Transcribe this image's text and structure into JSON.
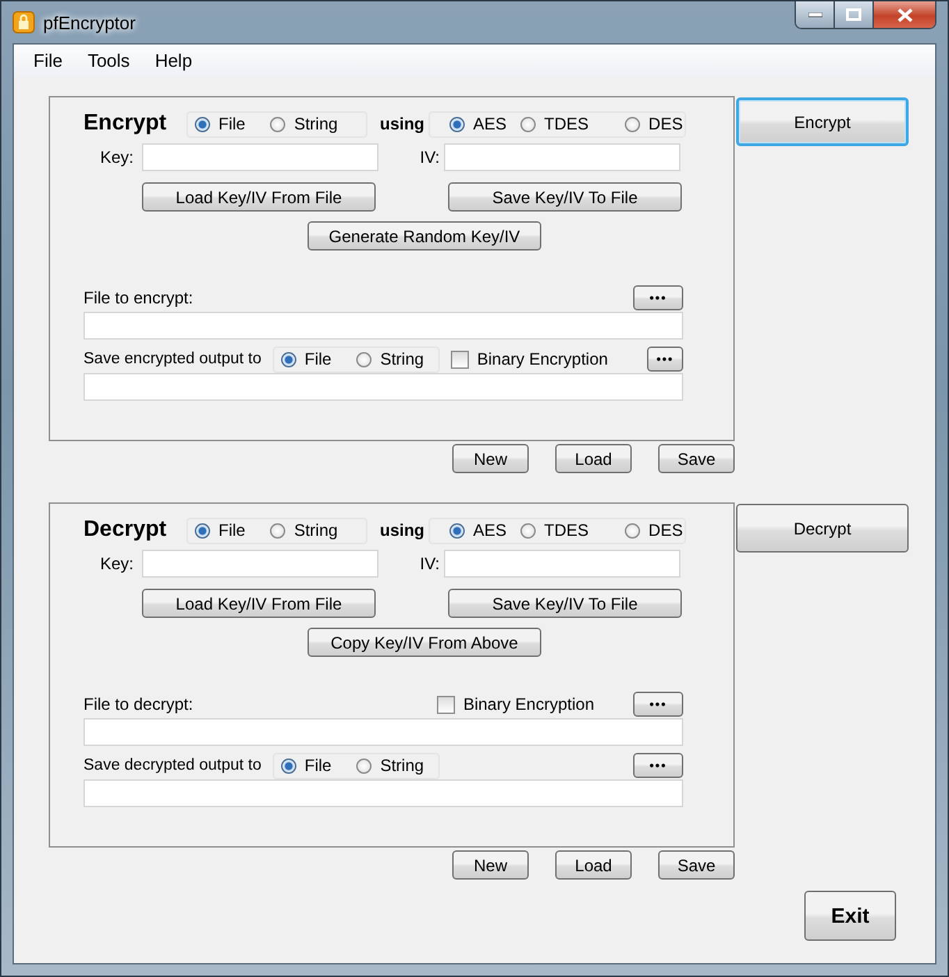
{
  "window": {
    "title": "pfEncryptor"
  },
  "menu": [
    {
      "label": "File"
    },
    {
      "label": "Tools"
    },
    {
      "label": "Help"
    }
  ],
  "sections": [
    {
      "title": "Encrypt",
      "source_options": [
        {
          "label": "File",
          "selected": true
        },
        {
          "label": "String",
          "selected": false
        }
      ],
      "using_label": "using",
      "algorithms": [
        {
          "label": "AES",
          "selected": true
        },
        {
          "label": "TDES",
          "selected": false
        },
        {
          "label": "DES",
          "selected": false
        }
      ],
      "key_label": "Key:",
      "iv_label": "IV:",
      "load_button": "Load Key/IV From File",
      "save_button": "Save Key/IV To File",
      "extra_button": "Generate Random Key/IV",
      "file": {
        "label": "File to encrypt:",
        "browse_button": "•••"
      },
      "output": {
        "label": "Save encrypted output to",
        "options": [
          {
            "label": "File",
            "selected": true
          },
          {
            "label": "String",
            "selected": false
          }
        ],
        "binary": {
          "label": "Binary Encryption",
          "checked": false
        },
        "browse_button": "•••"
      },
      "action_button": {
        "label": "Encrypt",
        "focused": true
      },
      "footer_buttons": [
        "New",
        "Load",
        "Save"
      ]
    },
    {
      "title": "Decrypt",
      "source_options": [
        {
          "label": "File",
          "selected": true
        },
        {
          "label": "String",
          "selected": false
        }
      ],
      "using_label": "using",
      "algorithms": [
        {
          "label": "AES",
          "selected": true
        },
        {
          "label": "TDES",
          "selected": false
        },
        {
          "label": "DES",
          "selected": false
        }
      ],
      "key_label": "Key:",
      "iv_label": "IV:",
      "load_button": "Load Key/IV From File",
      "save_button": "Save Key/IV To File",
      "extra_button": "Copy Key/IV From Above",
      "file": {
        "label": "File to decrypt:",
        "binary": {
          "label": "Binary Encryption",
          "checked": false
        },
        "browse_button": "•••"
      },
      "output": {
        "label": "Save decrypted output to",
        "options": [
          {
            "label": "File",
            "selected": true
          },
          {
            "label": "String",
            "selected": false
          }
        ],
        "browse_button": "•••"
      },
      "action_button": {
        "label": "Decrypt",
        "focused": false
      },
      "footer_buttons": [
        "New",
        "Load",
        "Save"
      ]
    }
  ],
  "exit_button": "Exit"
}
